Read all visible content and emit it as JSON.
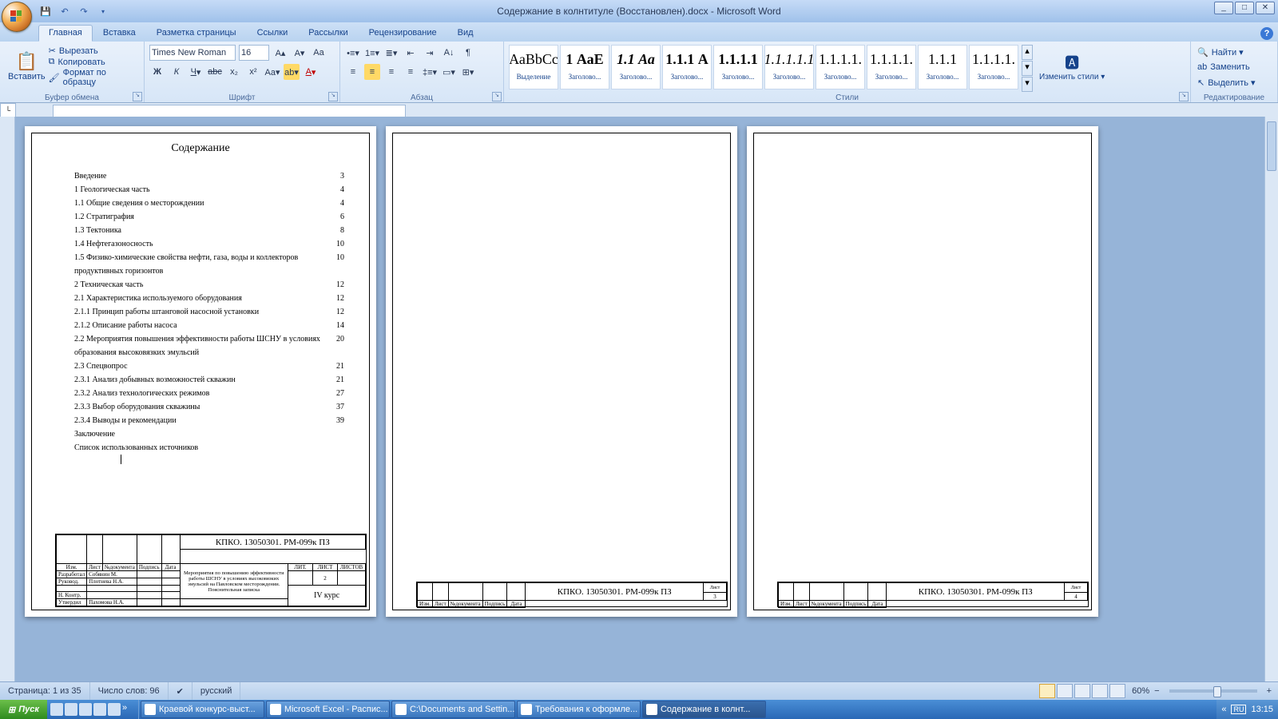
{
  "window": {
    "title": "Содержание в колнтитуле (Восстановлен).docx - Microsoft Word"
  },
  "tabs": {
    "home": "Главная",
    "insert": "Вставка",
    "layout": "Разметка страницы",
    "refs": "Ссылки",
    "mail": "Рассылки",
    "review": "Рецензирование",
    "view": "Вид"
  },
  "clipboard": {
    "paste": "Вставить",
    "cut": "Вырезать",
    "copy": "Копировать",
    "painter": "Формат по образцу",
    "label": "Буфер обмена"
  },
  "font": {
    "name": "Times New Roman",
    "size": "16",
    "label": "Шрифт"
  },
  "para": {
    "label": "Абзац"
  },
  "styles": {
    "label": "Стили",
    "change": "Изменить стили ▾",
    "items": [
      {
        "prev": "АаBbCc",
        "name": "Выделение"
      },
      {
        "prev": "1 АаE",
        "name": "Заголово...",
        "bold": true
      },
      {
        "prev": "1.1 Аа",
        "name": "Заголово...",
        "italic": true,
        "bold": true
      },
      {
        "prev": "1.1.1 А",
        "name": "Заголово...",
        "bold": true
      },
      {
        "prev": "1.1.1.1",
        "name": "Заголово...",
        "bold": true
      },
      {
        "prev": "1.1.1.1.1",
        "name": "Заголово...",
        "italic": true
      },
      {
        "prev": "1.1.1.1.",
        "name": "Заголово..."
      },
      {
        "prev": "1.1.1.1.",
        "name": "Заголово..."
      },
      {
        "prev": "1.1.1",
        "name": "Заголово..."
      },
      {
        "prev": "1.1.1.1.",
        "name": "Заголово..."
      }
    ]
  },
  "editing": {
    "find": "Найти ▾",
    "replace": "Заменить",
    "select": "Выделить ▾",
    "label": "Редактирование"
  },
  "toc": {
    "title": "Содержание",
    "rows": [
      {
        "t": "Введение",
        "p": "3"
      },
      {
        "t": "1 Геологическая часть",
        "p": "4"
      },
      {
        "t": "1.1 Общие сведения о месторождении",
        "p": "4"
      },
      {
        "t": "1.2 Стратиграфия",
        "p": "6"
      },
      {
        "t": "1.3 Тектоника",
        "p": "8"
      },
      {
        "t": "1.4 Нефтегазоносность",
        "p": "10"
      },
      {
        "t": "1.5 Физико-химические свойства нефти, газа, воды и коллекторов продуктивных горизонтов",
        "p": "10",
        "wrap": true
      },
      {
        "t": "2 Техническая часть",
        "p": "12"
      },
      {
        "t": "2.1 Характеристика используемого оборудования",
        "p": "12"
      },
      {
        "t": "2.1.1 Принцип работы штанговой насосной установки",
        "p": "12"
      },
      {
        "t": "2.1.2 Описание работы насоса",
        "p": "14"
      },
      {
        "t": "2.2 Мероприятия повышения эффективности работы ШСНУ в условиях образования высоковязких эмульсий",
        "p": "20",
        "wrap": true
      },
      {
        "t": "2.3 Спецвопрос",
        "p": "21"
      },
      {
        "t": "2.3.1 Анализ добывных возможностей скважин",
        "p": "21"
      },
      {
        "t": "2.3.2 Анализ технологических режимов",
        "p": "27"
      },
      {
        "t": "2.3.3 Выбор оборудования скважины",
        "p": "37"
      },
      {
        "t": "2.3.4 Выводы и рекомендации",
        "p": "39"
      },
      {
        "t": "Заключение",
        "p": ""
      },
      {
        "t": "Список использованных источников",
        "p": ""
      }
    ]
  },
  "stamp": {
    "code": "КПКО. 13050301. РМ-099к ПЗ",
    "hdr": {
      "izm": "Изм.",
      "list": "Лист",
      "ndoc": "№документа",
      "sign": "Подпись",
      "date": "Дата"
    },
    "rows": {
      "dev": "Разработал",
      "dev_name": "Собянин М.",
      "lead": "Руковод.",
      "lead_name": "Плотнева Н.А.",
      "norm": "Н. Контр.",
      "appr": "Утвердил",
      "appr_name": "Пахомова Н.А."
    },
    "descr": "Мероприятия по повышению эффективности работы ШСНУ в условиях высоковязких эмульсий на Павловском месторождении. Пояснительная записка",
    "cols": {
      "lit": "ЛИТ.",
      "sheet": "ЛИСТ",
      "sheets": "ЛИСТОВ",
      "sheet_v": "2"
    },
    "course": "IV курс",
    "small": {
      "sheet_label": "Лист",
      "p3": "3",
      "p4": "4"
    }
  },
  "status": {
    "page": "Страница: 1 из 35",
    "words": "Число слов: 96",
    "lang": "русский",
    "zoom": "60%"
  },
  "taskbar": {
    "start": "Пуск",
    "tasks": [
      "Краевой конкурс-выст...",
      "Microsoft Excel - Распис...",
      "C:\\Documents and Settin...",
      "Требования к оформле...",
      "Содержание в колнт..."
    ],
    "time": "13:15"
  }
}
